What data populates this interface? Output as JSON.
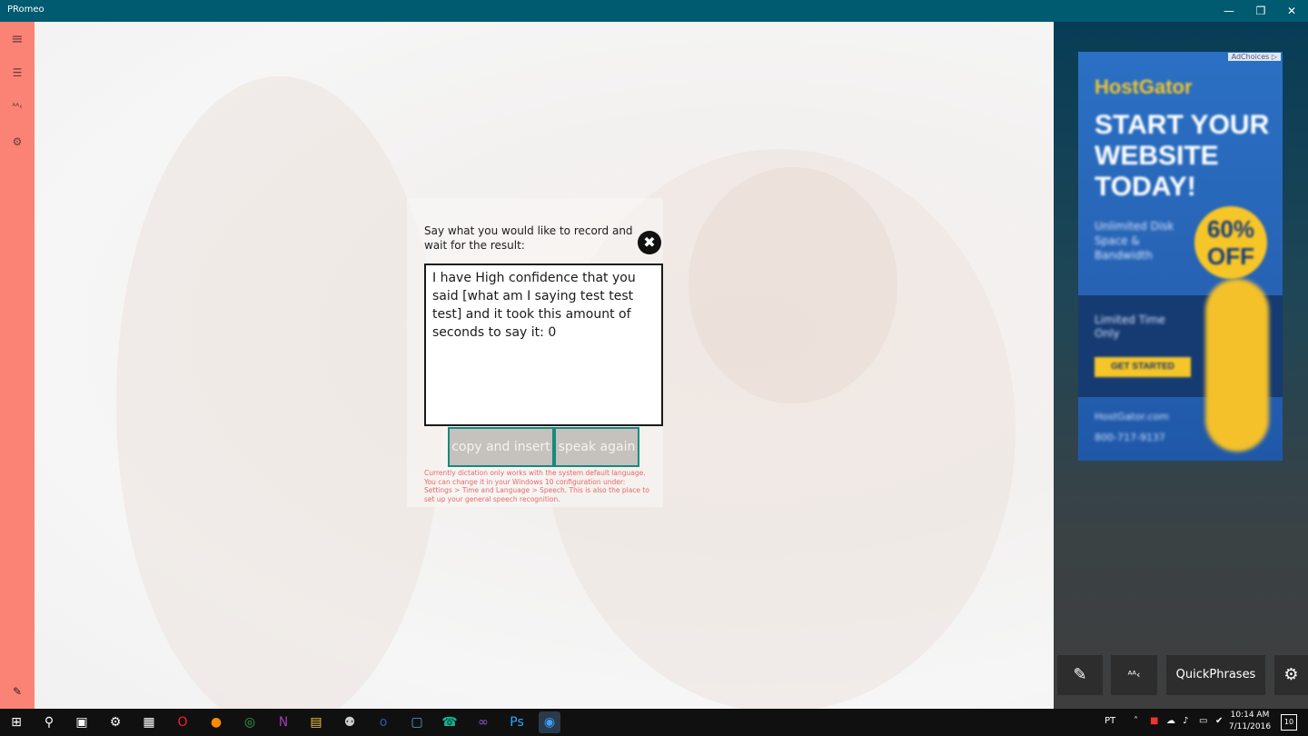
{
  "window": {
    "title": "PRomeo",
    "minimize_glyph": "—",
    "restore_glyph": "❐",
    "close_glyph": "✕"
  },
  "sidebar": {
    "items": [
      {
        "name": "hamburger-menu-icon",
        "glyph": "≡"
      },
      {
        "name": "list-icon",
        "glyph": "☰"
      },
      {
        "name": "text-size-icon",
        "glyph": "ᴬᴬ‹"
      },
      {
        "name": "gear-icon",
        "glyph": "⚙"
      }
    ],
    "bottom_icon": {
      "name": "pen-icon",
      "glyph": "✎"
    }
  },
  "dialog": {
    "prompt": "Say what you would like to record and wait for the result:",
    "close_glyph": "✖",
    "result_text": "I have High  confidence that you said [what am I saying test test test]  and it took this amount of seconds to say it:  0",
    "copy_button": "copy and insert",
    "speak_button": "speak again",
    "note": "Currently dictation only works with the system default language. You can change it in your Windows 10 configuration under: Settings > Time and Language > Speech. This is also the place to set up your general speech recognition."
  },
  "ad": {
    "adchoices": "AdChoices ▷",
    "brand": "HostGator",
    "headline": "START YOUR WEBSITE TODAY!",
    "badge": "60% OFF",
    "sub": "Unlimited Disk Space & Bandwidth",
    "band": "Limited Time Only",
    "cta": "GET STARTED",
    "contact_1": "HostGator.com",
    "contact_2": "800-717-9137"
  },
  "bottom_toolbar": {
    "pen_glyph": "✎",
    "text_size_glyph": "ᴬᴬ‹",
    "quickphrases": "QuickPhrases",
    "settings_glyph": "⚙"
  },
  "taskbar": {
    "icons": [
      {
        "name": "start-icon",
        "glyph": "⊞",
        "color": "#ffffff"
      },
      {
        "name": "search-icon",
        "glyph": "⚲",
        "color": "#ffffff"
      },
      {
        "name": "task-view-icon",
        "glyph": "▣",
        "color": "#ffffff"
      },
      {
        "name": "settings-app-icon",
        "glyph": "⚙",
        "color": "#ffffff"
      },
      {
        "name": "store-icon",
        "glyph": "▦",
        "color": "#ffffff"
      },
      {
        "name": "opera-icon",
        "glyph": "O",
        "color": "#ff1b2d"
      },
      {
        "name": "firefox-icon",
        "glyph": "●",
        "color": "#ff8a00"
      },
      {
        "name": "chrome-icon",
        "glyph": "◎",
        "color": "#34a853"
      },
      {
        "name": "onenote-icon",
        "glyph": "N",
        "color": "#a53bb8"
      },
      {
        "name": "file-explorer-icon",
        "glyph": "▤",
        "color": "#f5c542"
      },
      {
        "name": "app-icon",
        "glyph": "⚉",
        "color": "#cccccc"
      },
      {
        "name": "outlook-icon",
        "glyph": "o",
        "color": "#1d5fb0"
      },
      {
        "name": "monitor-app-icon",
        "glyph": "▢",
        "color": "#5aa0c8"
      },
      {
        "name": "phone-icon",
        "glyph": "☎",
        "color": "#19b394"
      },
      {
        "name": "visual-studio-icon",
        "glyph": "∞",
        "color": "#8a5bd6"
      },
      {
        "name": "photoshop-icon",
        "glyph": "Ps",
        "color": "#30a8ff"
      },
      {
        "name": "promeo-icon",
        "glyph": "◉",
        "color": "#3aa0ff"
      }
    ],
    "language": "PT",
    "tray_glyphs": [
      "˄",
      "■",
      "☁",
      "♪",
      "▭",
      "✔"
    ],
    "time": "10:14 AM",
    "date": "7/11/2016",
    "notification_count": "10"
  },
  "colors": {
    "titlebar": "#005a70",
    "sidebar": "#fb8375",
    "button_border": "#178a7e",
    "note_text": "#e46a6a"
  }
}
